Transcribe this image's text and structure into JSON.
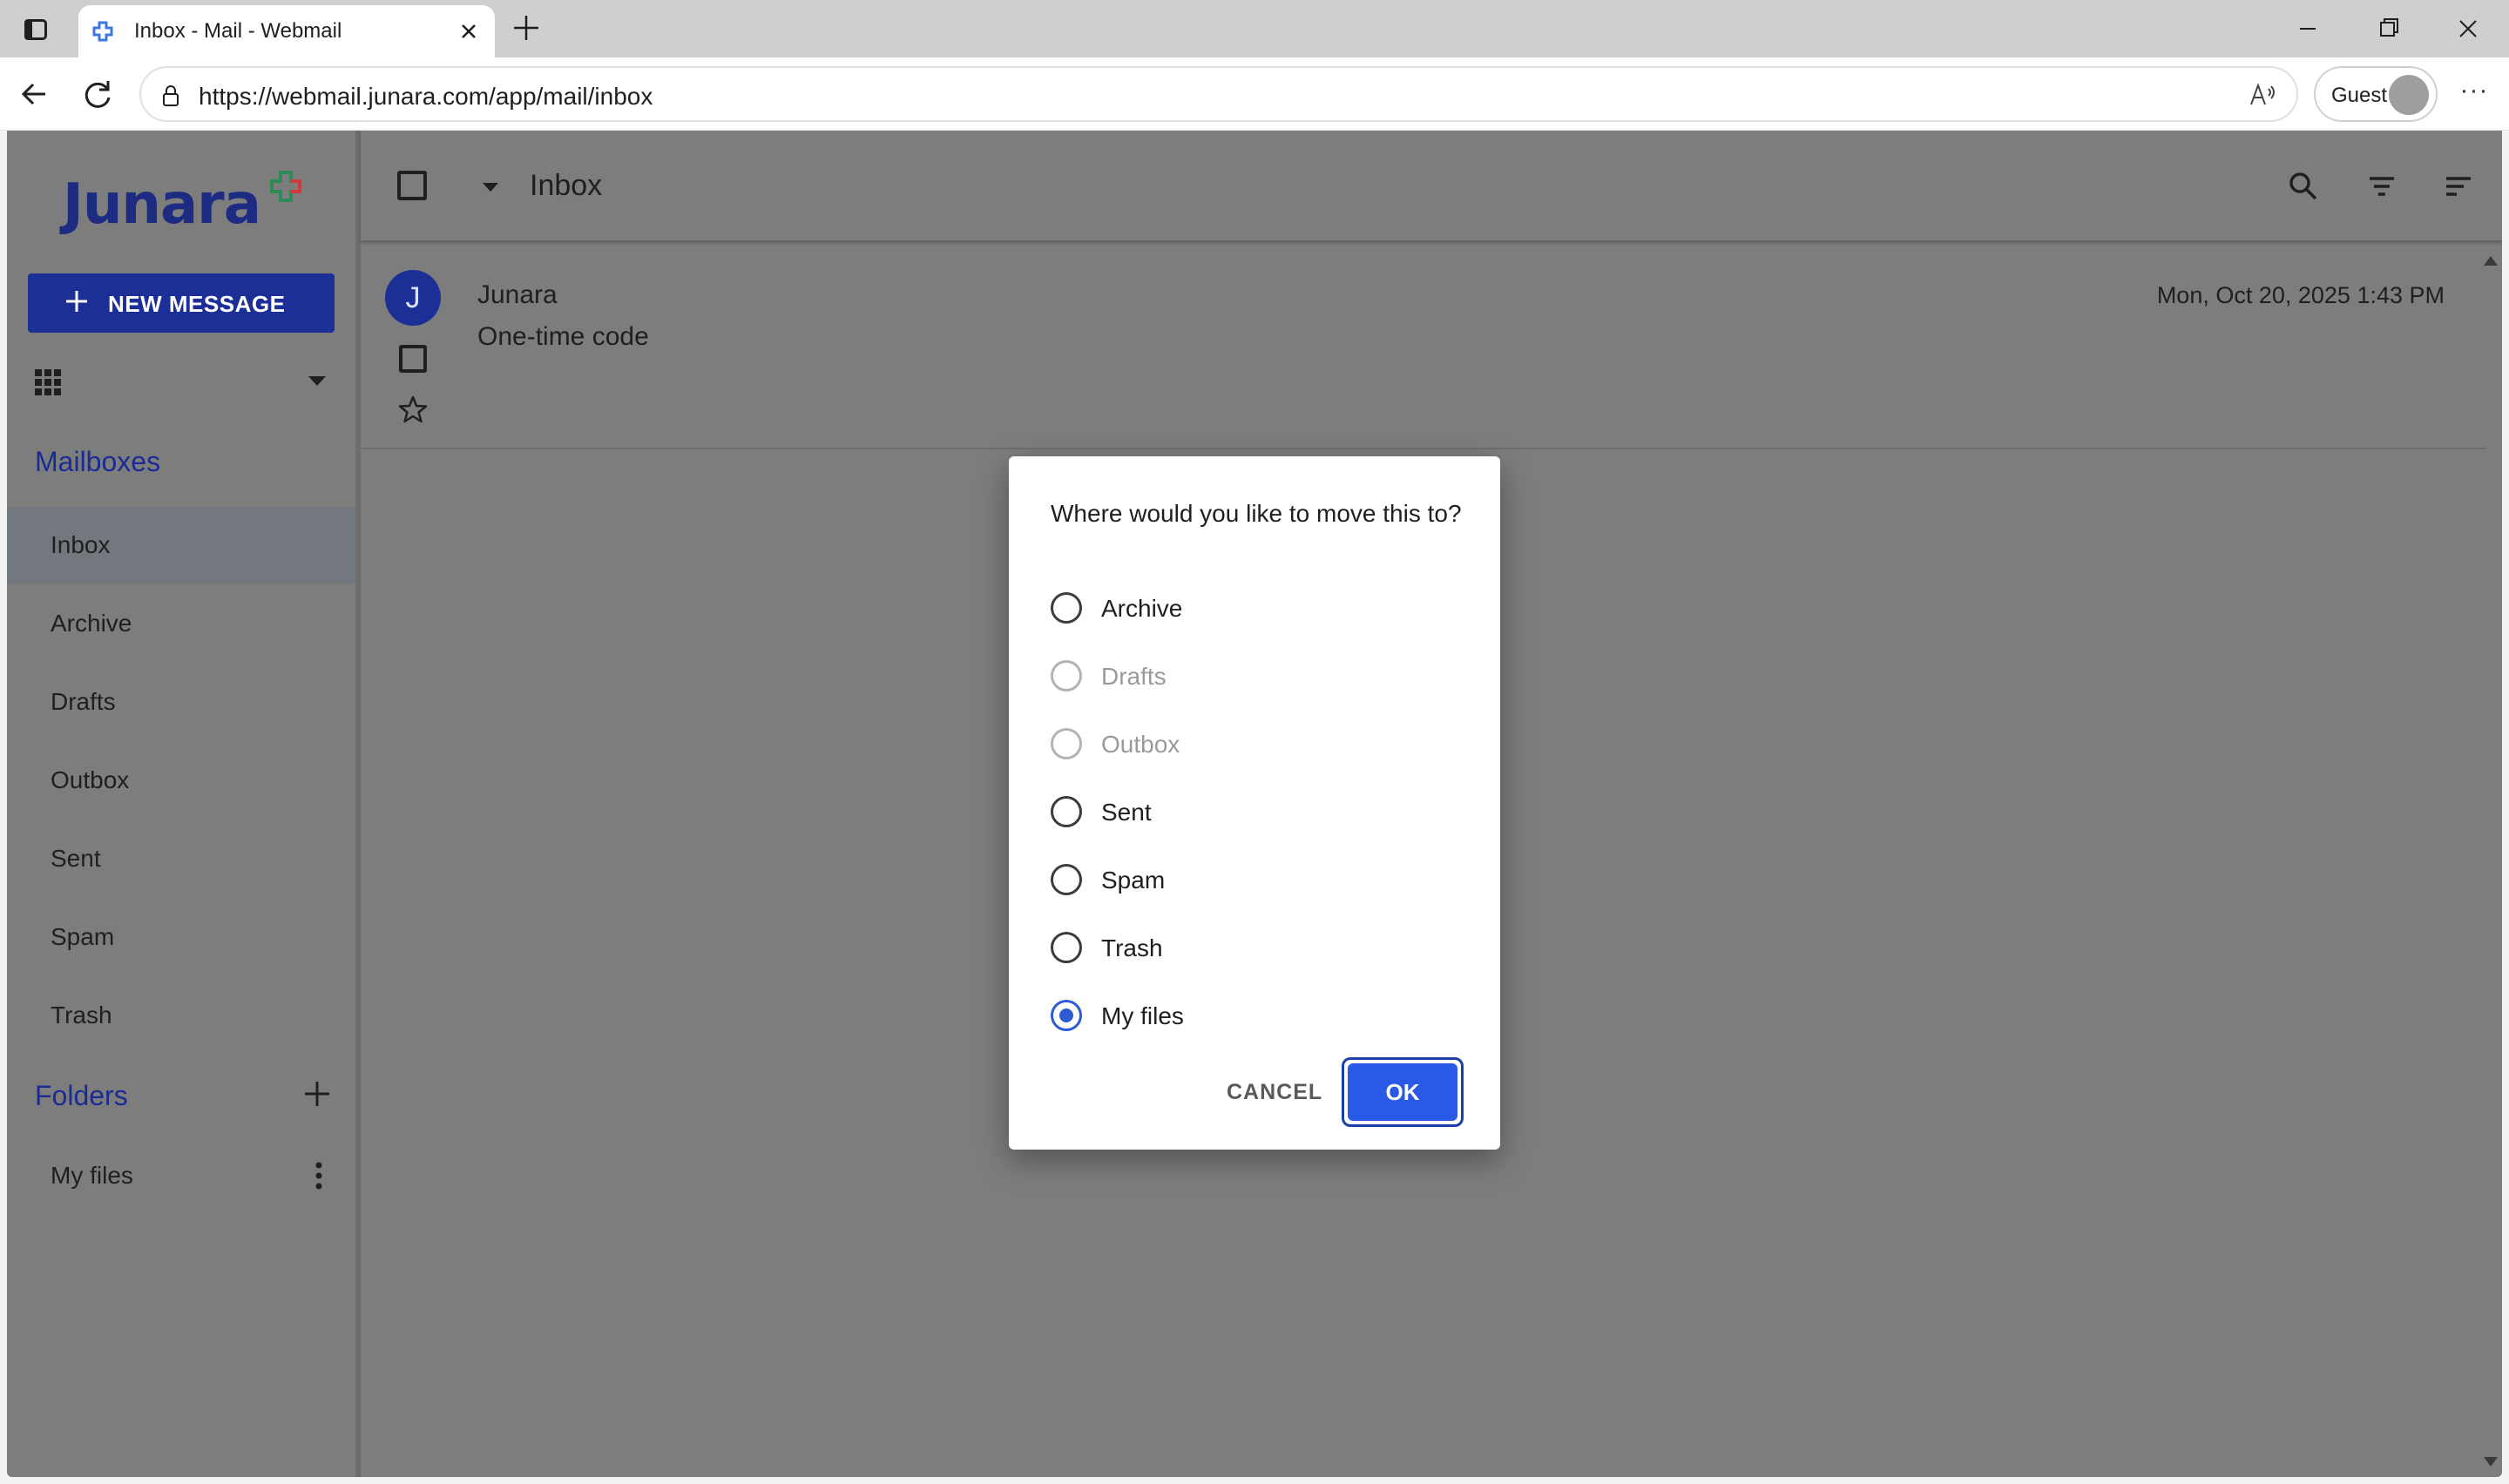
{
  "browser": {
    "tab_title": "Inbox - Mail - Webmail",
    "url": "https://webmail.junara.com/app/mail/inbox",
    "profile_label": "Guest"
  },
  "app": {
    "logo_text": "Junara",
    "new_message_label": "NEW MESSAGE",
    "mailboxes_heading": "Mailboxes",
    "mailboxes": [
      {
        "label": "Inbox",
        "active": true
      },
      {
        "label": "Archive"
      },
      {
        "label": "Drafts"
      },
      {
        "label": "Outbox"
      },
      {
        "label": "Sent"
      },
      {
        "label": "Spam"
      },
      {
        "label": "Trash"
      }
    ],
    "folders_heading": "Folders",
    "folders": [
      {
        "label": "My files"
      }
    ],
    "toolbar_title": "Inbox",
    "messages": [
      {
        "avatar_letter": "J",
        "sender": "Junara",
        "subject": "One-time code",
        "date": "Mon, Oct 20, 2025 1:43 PM"
      }
    ]
  },
  "dialog": {
    "title": "Where would you like to move this to?",
    "options": [
      {
        "label": "Archive",
        "disabled": false,
        "checked": false
      },
      {
        "label": "Drafts",
        "disabled": true,
        "checked": false
      },
      {
        "label": "Outbox",
        "disabled": true,
        "checked": false
      },
      {
        "label": "Sent",
        "disabled": false,
        "checked": false
      },
      {
        "label": "Spam",
        "disabled": false,
        "checked": false
      },
      {
        "label": "Trash",
        "disabled": false,
        "checked": false
      },
      {
        "label": "My files",
        "disabled": false,
        "checked": true
      }
    ],
    "cancel_label": "CANCEL",
    "ok_label": "OK"
  },
  "colors": {
    "brand": "#1b2f96",
    "accent": "#2a59e8",
    "overlay": "#7d7d7d"
  }
}
